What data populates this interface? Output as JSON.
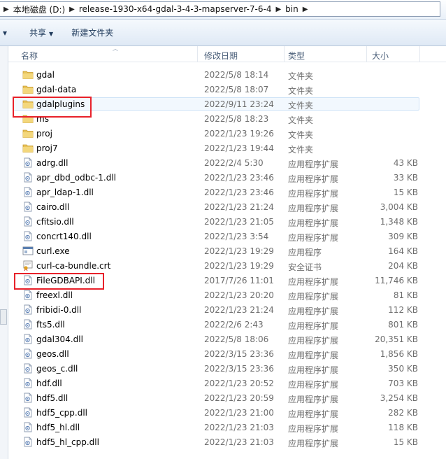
{
  "address": {
    "segments": [
      "本地磁盘 (D:)",
      "release-1930-x64-gdal-3-4-3-mapserver-7-6-4",
      "bin"
    ]
  },
  "toolbar": {
    "share_label": "共享",
    "new_folder_label": "新建文件夹"
  },
  "columns": {
    "name": "名称",
    "date": "修改日期",
    "type": "类型",
    "size": "大小"
  },
  "files": [
    {
      "name": "gdal",
      "date": "2022/5/8 18:14",
      "type": "文件夹",
      "size": "",
      "icon": "folder-icon"
    },
    {
      "name": "gdal-data",
      "date": "2022/5/8 18:07",
      "type": "文件夹",
      "size": "",
      "icon": "folder-icon"
    },
    {
      "name": "gdalplugins",
      "date": "2022/9/11 23:24",
      "type": "文件夹",
      "size": "",
      "icon": "folder-icon"
    },
    {
      "name": "ms",
      "date": "2022/5/8 18:23",
      "type": "文件夹",
      "size": "",
      "icon": "folder-icon"
    },
    {
      "name": "proj",
      "date": "2022/1/23 19:26",
      "type": "文件夹",
      "size": "",
      "icon": "folder-icon"
    },
    {
      "name": "proj7",
      "date": "2022/1/23 19:44",
      "type": "文件夹",
      "size": "",
      "icon": "folder-icon"
    },
    {
      "name": "adrg.dll",
      "date": "2022/2/4 5:30",
      "type": "应用程序扩展",
      "size": "43 KB",
      "icon": "dll-icon"
    },
    {
      "name": "apr_dbd_odbc-1.dll",
      "date": "2022/1/23 23:46",
      "type": "应用程序扩展",
      "size": "33 KB",
      "icon": "dll-icon"
    },
    {
      "name": "apr_ldap-1.dll",
      "date": "2022/1/23 23:46",
      "type": "应用程序扩展",
      "size": "15 KB",
      "icon": "dll-icon"
    },
    {
      "name": "cairo.dll",
      "date": "2022/1/23 21:24",
      "type": "应用程序扩展",
      "size": "3,004 KB",
      "icon": "dll-icon"
    },
    {
      "name": "cfitsio.dll",
      "date": "2022/1/23 21:05",
      "type": "应用程序扩展",
      "size": "1,348 KB",
      "icon": "dll-icon"
    },
    {
      "name": "concrt140.dll",
      "date": "2022/1/23 3:54",
      "type": "应用程序扩展",
      "size": "309 KB",
      "icon": "dll-icon"
    },
    {
      "name": "curl.exe",
      "date": "2022/1/23 19:29",
      "type": "应用程序",
      "size": "164 KB",
      "icon": "exe-icon"
    },
    {
      "name": "curl-ca-bundle.crt",
      "date": "2022/1/23 19:29",
      "type": "安全证书",
      "size": "204 KB",
      "icon": "certificate-icon"
    },
    {
      "name": "FileGDBAPI.dll",
      "date": "2017/7/26 11:01",
      "type": "应用程序扩展",
      "size": "11,746 KB",
      "icon": "dll-icon"
    },
    {
      "name": "freexl.dll",
      "date": "2022/1/23 20:20",
      "type": "应用程序扩展",
      "size": "81 KB",
      "icon": "dll-icon"
    },
    {
      "name": "fribidi-0.dll",
      "date": "2022/1/23 21:24",
      "type": "应用程序扩展",
      "size": "112 KB",
      "icon": "dll-icon"
    },
    {
      "name": "fts5.dll",
      "date": "2022/2/6 2:43",
      "type": "应用程序扩展",
      "size": "801 KB",
      "icon": "dll-icon"
    },
    {
      "name": "gdal304.dll",
      "date": "2022/5/8 18:06",
      "type": "应用程序扩展",
      "size": "20,351 KB",
      "icon": "dll-icon"
    },
    {
      "name": "geos.dll",
      "date": "2022/3/15 23:36",
      "type": "应用程序扩展",
      "size": "1,856 KB",
      "icon": "dll-icon"
    },
    {
      "name": "geos_c.dll",
      "date": "2022/3/15 23:36",
      "type": "应用程序扩展",
      "size": "350 KB",
      "icon": "dll-icon"
    },
    {
      "name": "hdf.dll",
      "date": "2022/1/23 20:52",
      "type": "应用程序扩展",
      "size": "703 KB",
      "icon": "dll-icon"
    },
    {
      "name": "hdf5.dll",
      "date": "2022/1/23 20:59",
      "type": "应用程序扩展",
      "size": "3,254 KB",
      "icon": "dll-icon"
    },
    {
      "name": "hdf5_cpp.dll",
      "date": "2022/1/23 21:00",
      "type": "应用程序扩展",
      "size": "282 KB",
      "icon": "dll-icon"
    },
    {
      "name": "hdf5_hl.dll",
      "date": "2022/1/23 21:03",
      "type": "应用程序扩展",
      "size": "118 KB",
      "icon": "dll-icon"
    },
    {
      "name": "hdf5_hl_cpp.dll",
      "date": "2022/1/23 21:03",
      "type": "应用程序扩展",
      "size": "15 KB",
      "icon": "dll-icon"
    }
  ],
  "selected_file": "gdalplugins",
  "highlighted_files": [
    "gdalplugins",
    "FileGDBAPI.dll"
  ],
  "colors": {
    "highlight_box": "#e8212a",
    "folder": "#e8c35a",
    "selection": "#cfe3f7"
  }
}
